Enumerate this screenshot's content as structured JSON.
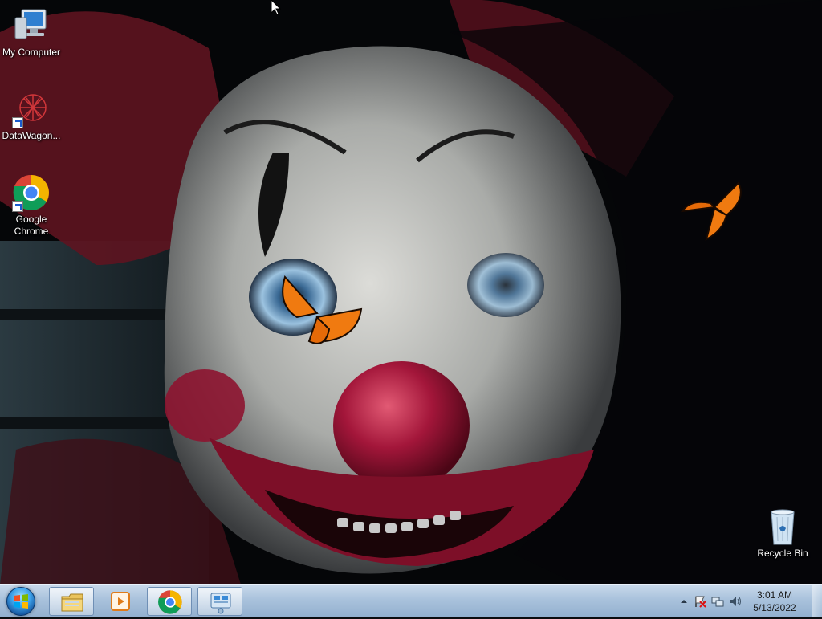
{
  "desktop": {
    "icons": [
      {
        "label": "My Computer",
        "icon": "computer-icon"
      },
      {
        "label": "DataWagon...",
        "icon": "datawagon-icon"
      },
      {
        "label": "Google Chrome",
        "icon": "chrome-icon"
      },
      {
        "label": "Recycle Bin",
        "icon": "recycle-bin-icon"
      }
    ],
    "wallpaper": "clown-wallpaper"
  },
  "taskbar": {
    "start_icon": "windows-logo-icon",
    "pinned": [
      {
        "icon": "file-explorer-icon",
        "active": true
      },
      {
        "icon": "media-player-icon",
        "active": false
      },
      {
        "icon": "chrome-icon",
        "active": true
      },
      {
        "icon": "control-panel-icon",
        "active": true
      }
    ],
    "tray": {
      "icons": [
        "show-hidden-icons-chevron-icon",
        "action-center-flag-icon",
        "network-icon",
        "volume-icon"
      ],
      "time": "3:01 AM",
      "date": "5/13/2022"
    }
  },
  "colors": {
    "taskbar_top": "#c7d8ea",
    "taskbar_bottom": "#93b0cf",
    "clown_nose": "#a3163a",
    "butterfly": "#f07a10"
  }
}
